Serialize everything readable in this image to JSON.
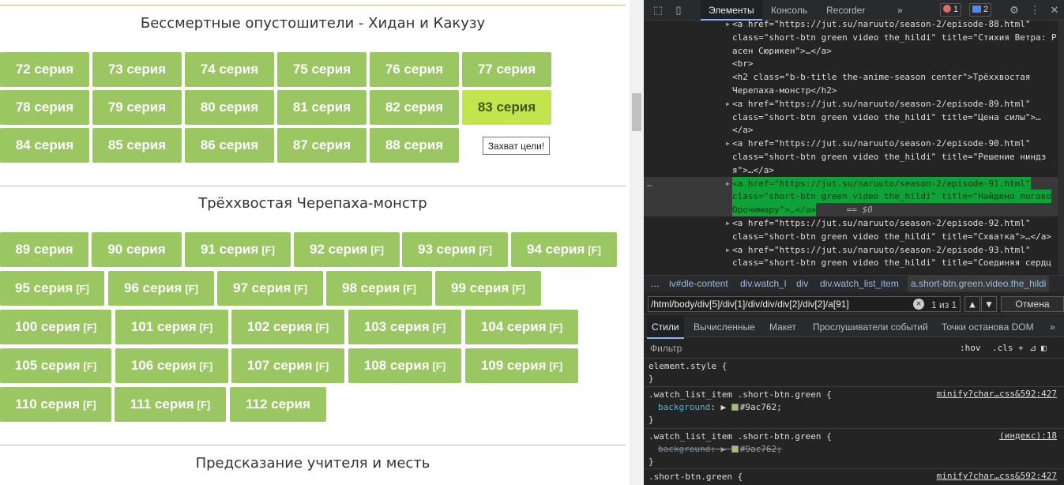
{
  "page": {
    "seasons": [
      {
        "title": "Бессмертные опустошители - Хидан и Какузу",
        "episodes": [
          {
            "label": "72 серия",
            "f": false
          },
          {
            "label": "73 серия",
            "f": false
          },
          {
            "label": "74 серия",
            "f": false
          },
          {
            "label": "75 серия",
            "f": false
          },
          {
            "label": "76 серия",
            "f": false
          },
          {
            "label": "77 серия",
            "f": false
          },
          {
            "label": "78 серия",
            "f": false
          },
          {
            "label": "79 серия",
            "f": false
          },
          {
            "label": "80 серия",
            "f": false
          },
          {
            "label": "81 серия",
            "f": false
          },
          {
            "label": "82 серия",
            "f": false
          },
          {
            "label": "83 серия",
            "f": false
          },
          {
            "label": "84 серия",
            "f": false
          },
          {
            "label": "85 серия",
            "f": false
          },
          {
            "label": "86 серия",
            "f": false
          },
          {
            "label": "87 серия",
            "f": false
          },
          {
            "label": "88 серия",
            "f": false
          }
        ]
      },
      {
        "title": "Трёххвостая Черепаха-монстр",
        "episodes": [
          {
            "label": "89 серия",
            "f": false
          },
          {
            "label": "90 серия",
            "f": false
          },
          {
            "label": "91 серия",
            "f": true
          },
          {
            "label": "92 серия",
            "f": true
          },
          {
            "label": "93 серия",
            "f": true
          },
          {
            "label": "94 серия",
            "f": true
          },
          {
            "label": "95 серия",
            "f": true
          },
          {
            "label": "96 серия",
            "f": true
          },
          {
            "label": "97 серия",
            "f": true
          },
          {
            "label": "98 серия",
            "f": true
          },
          {
            "label": "99 серия",
            "f": true
          },
          {
            "label": "100 серия",
            "f": true
          },
          {
            "label": "101 серия",
            "f": true
          },
          {
            "label": "102 серия",
            "f": true
          },
          {
            "label": "103 серия",
            "f": true
          },
          {
            "label": "104 серия",
            "f": true
          },
          {
            "label": "105 серия",
            "f": true
          },
          {
            "label": "106 серия",
            "f": true
          },
          {
            "label": "107 серия",
            "f": true
          },
          {
            "label": "108 серия",
            "f": true
          },
          {
            "label": "109 серия",
            "f": true
          },
          {
            "label": "110 серия",
            "f": true
          },
          {
            "label": "111 серия",
            "f": true
          },
          {
            "label": "112 серия",
            "f": false
          }
        ]
      },
      {
        "title": "Предсказание учителя и месть",
        "episodes": []
      }
    ],
    "filler_mark": "[F]",
    "tooltip": "Захват цели!",
    "colors": {
      "button": "#9ac762",
      "button_hover": "#c2e54e"
    }
  },
  "devtools": {
    "tabs": [
      "Элементы",
      "Консоль",
      "Recorder"
    ],
    "more": "»",
    "errors": "1",
    "messages": "2",
    "dom": [
      {
        "t": "<a href=\"https://jut.su/naruuto/season-2/episode-88.html\"",
        "kind": "a"
      },
      {
        "t": "class=\"short-btn green video the_hildi\" title=\"Стихия Ветра: Р",
        "kind": "c"
      },
      {
        "t": "асен Сюрикен\">…</a>",
        "kind": "c"
      },
      {
        "t": "<br>",
        "kind": "c"
      },
      {
        "t": "<h2 class=\"b-b-title the-anime-season center\">Трёххвостая",
        "kind": "c"
      },
      {
        "t": "Черепаха-монстр</h2>",
        "kind": "c"
      },
      {
        "t": "<a href=\"https://jut.su/naruuto/season-2/episode-89.html\"",
        "kind": "a"
      },
      {
        "t": "class=\"short-btn green video the_hildi\" title=\"Цена силы\">…",
        "kind": "c"
      },
      {
        "t": "</a>",
        "kind": "c"
      },
      {
        "t": "<a href=\"https://jut.su/naruuto/season-2/episode-90.html\"",
        "kind": "a"
      },
      {
        "t": "class=\"short-btn green video the_hildi\" title=\"Решение ниндз",
        "kind": "c"
      },
      {
        "t": "я\">…</a>",
        "kind": "c"
      },
      {
        "t": "<a href=\"https://jut.su/naruuto/season-2/episode-91.html\"",
        "kind": "sel"
      },
      {
        "t": "class=\"short-btn green video the_hildi\" title=\"Найдено логово",
        "kind": "sel"
      },
      {
        "t": "Орочимару\">…</a>",
        "kind": "sel"
      },
      {
        "t": "<a href=\"https://jut.su/naruuto/season-2/episode-92.html\"",
        "kind": "a"
      },
      {
        "t": "class=\"short-btn green video the_hildi\" title=\"Схватка\">…</a>",
        "kind": "c"
      },
      {
        "t": "<a href=\"https://jut.su/naruuto/season-2/episode-93.html\"",
        "kind": "a"
      },
      {
        "t": "class=\"short-btn green video the_hildi\" title=\"Соединяя сердц",
        "kind": "c"
      }
    ],
    "eq0": "== $0",
    "crumbs": [
      "…",
      "iv#dle-content",
      "div.watch_l",
      "div",
      "div.watch_list_item",
      "a.short-btn.green.video.the_hildi"
    ],
    "search_value": "/html/body/div[5]/div[1]/div/div/div[2]/div[2]/a[91]",
    "match_count": "1 из 1",
    "cancel": "Отмена",
    "styles_tabs": [
      "Стили",
      "Вычисленные",
      "Макет",
      "Прослушиватели событий",
      "Точки останова DOM",
      "»"
    ],
    "filter_placeholder": "Фильтр",
    "hov": ":hov",
    "cls": ".cls",
    "rules": [
      {
        "selector": "element.style {",
        "source": "",
        "props": [],
        "close": "}"
      },
      {
        "selector": ".watch_list_item .short-btn.green {",
        "source": "minify?char…css&592:427",
        "props": [
          {
            "name": "background",
            "value": "#9ac762;",
            "strike": false
          }
        ],
        "close": "}"
      },
      {
        "selector": ".watch_list_item .short-btn.green {",
        "source": "(индекс):18",
        "props": [
          {
            "name": "background",
            "value": "#9ac762;",
            "strike": true
          }
        ],
        "close": "}"
      },
      {
        "selector": ".short-btn.green {",
        "source": "minify?char…css&592:427",
        "props": [],
        "close": ""
      }
    ]
  }
}
